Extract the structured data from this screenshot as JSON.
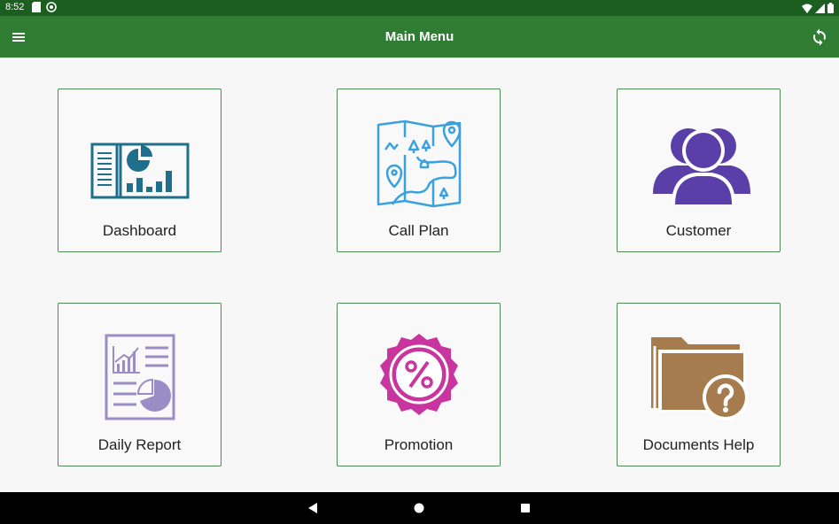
{
  "status_bar": {
    "time": "8:52",
    "icons_left": [
      "sd-card-icon",
      "app-notification-icon"
    ],
    "icons_right": [
      "wifi-icon",
      "signal-icon",
      "battery-icon"
    ]
  },
  "app_bar": {
    "title": "Main Menu",
    "left_icon": "hamburger-menu-icon",
    "right_icon": "sync-icon",
    "background": "#2e7d32"
  },
  "menu": {
    "tiles": [
      {
        "label": "Dashboard",
        "icon": "dashboard-icon",
        "color": "#1e6f8c"
      },
      {
        "label": "Call Plan",
        "icon": "map-icon",
        "color": "#3ba1de"
      },
      {
        "label": "Customer",
        "icon": "customer-group-icon",
        "color": "#5a3fa8"
      },
      {
        "label": "Daily Report",
        "icon": "report-icon",
        "color": "#9a8cc4"
      },
      {
        "label": "Promotion",
        "icon": "percent-badge-icon",
        "color": "#c9359f"
      },
      {
        "label": "Documents Help",
        "icon": "folder-help-icon",
        "color": "#a67c4e"
      }
    ]
  },
  "nav_bar": {
    "buttons": [
      "back-icon",
      "home-icon",
      "recents-icon"
    ]
  }
}
